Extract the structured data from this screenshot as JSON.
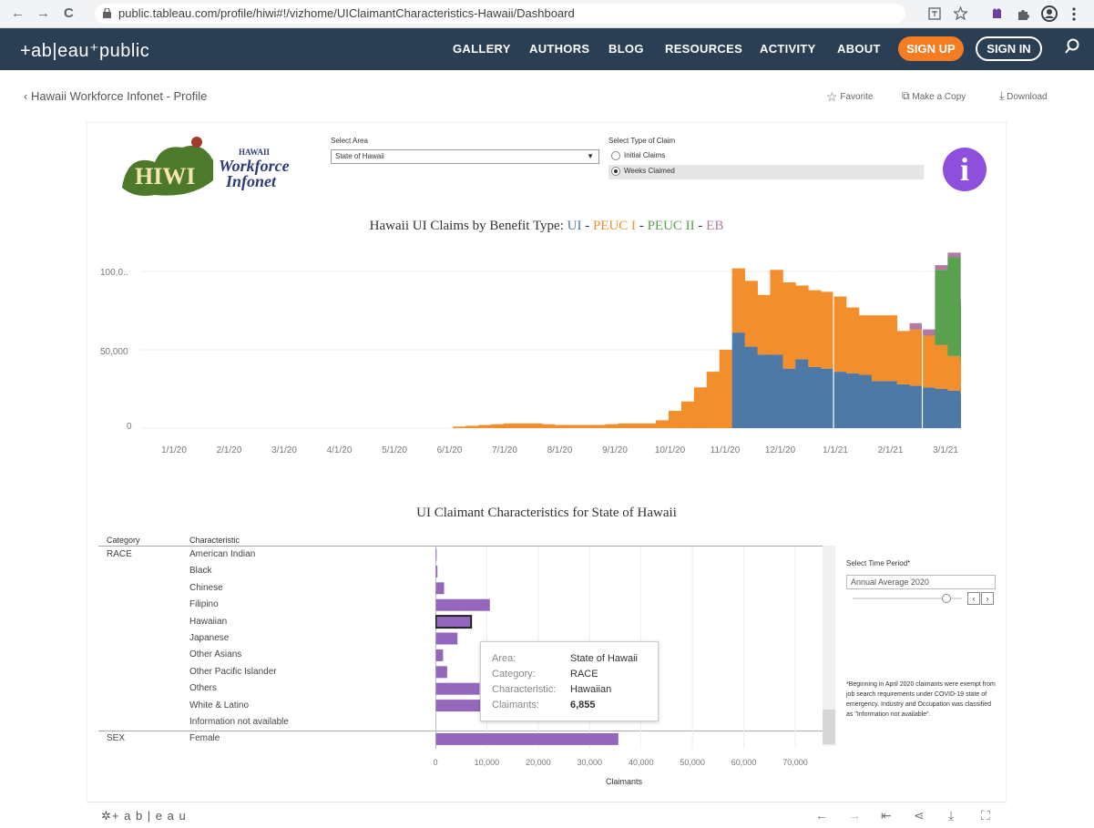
{
  "browser": {
    "url": "public.tableau.com/profile/hiwi#!/vizhome/UIClaimantCharacteristics-Hawaii/Dashboard",
    "back_glyph": "←",
    "forward_glyph": "→",
    "reload_glyph": "C"
  },
  "header": {
    "logo": "+ab|eau⁺public",
    "nav": [
      "GALLERY",
      "AUTHORS",
      "BLOG",
      "RESOURCES",
      "ACTIVITY",
      "ABOUT"
    ],
    "signup": "SIGN UP",
    "signin": "SIGN IN",
    "accent_color": "#f57c20",
    "bg_color": "#2a3f54"
  },
  "subheader": {
    "back_label": "Hawaii Workforce Infonet - Profile",
    "favorite": "Favorite",
    "copy": "Make a Copy",
    "download": "Download"
  },
  "dashboard": {
    "logo": {
      "badge": "HIWI",
      "line1": "HAWAII",
      "line2": "Workforce",
      "line3": "Infonet"
    },
    "select_area_label": "Select Area",
    "select_area_value": "State of Hawaii",
    "claim_type_label": "Select Type of Claim",
    "claim_options": [
      "Initial Claims",
      "Weeks Claimed"
    ],
    "claim_selected": "Weeks Claimed",
    "info_glyph": "i",
    "chart1_title_prefix": "Hawaii UI Claims by Benefit Type:",
    "chart1_title_parts": [
      "UI",
      "PEUC I",
      "PEUC II",
      "EB"
    ],
    "chart1_title_sep": " - ",
    "chart2_title": "UI Claimant Characteristics for State of Hawaii",
    "table_headers": {
      "category": "Category",
      "characteristic": "Characteristic"
    },
    "time_period_label": "Select Time Period*",
    "time_period_value": "Annual Average 2020",
    "note": "*Beginning in April 2020 claimants were exempt from job search requirements under COVID-19 state of emergency. Industry and Occupation was classified as \"Information not available\".",
    "tooltip": {
      "rows": [
        {
          "key": "Area:",
          "value": "State of Hawaii"
        },
        {
          "key": "Category:",
          "value": "RACE"
        },
        {
          "key": "Characteristic:",
          "value": "Hawaiian"
        },
        {
          "key": "Claimants:",
          "value": "6,855"
        }
      ]
    },
    "bottom_logo": "+ a b | e a u"
  },
  "chart_data": [
    {
      "type": "area",
      "title": "Hawaii UI Claims by Benefit Type: UI - PEUC I - PEUC II - EB",
      "x_ticks": [
        "1/1/20",
        "2/1/20",
        "3/1/20",
        "4/1/20",
        "5/1/20",
        "6/1/20",
        "7/1/20",
        "8/1/20",
        "9/1/20",
        "10/1/20",
        "11/1/20",
        "12/1/20",
        "1/1/21",
        "2/1/21",
        "3/1/21"
      ],
      "y_ticks": [
        "0",
        "50,000",
        "100,0.."
      ],
      "ylim": [
        0,
        120000
      ],
      "colors": {
        "UI": "#4e79a7",
        "PEUC I": "#f28e2b",
        "PEUC II": "#59a14f",
        "EB": "#b07aa1"
      },
      "weeks_from_start": [
        22,
        23,
        24,
        25,
        26,
        27,
        28,
        29,
        30,
        31,
        32,
        33,
        34,
        35,
        36,
        37,
        38,
        39,
        40,
        41,
        42,
        43,
        44,
        45,
        46,
        47,
        48,
        49,
        50,
        51,
        52,
        53,
        54,
        55,
        56,
        57,
        58,
        59,
        60,
        61,
        62
      ],
      "series": [
        {
          "name": "UI",
          "values": [
            0,
            0,
            0,
            0,
            0,
            0,
            0,
            0,
            0,
            0,
            0,
            0,
            0,
            0,
            0,
            0,
            0,
            0,
            0,
            0,
            0,
            0,
            61000,
            52000,
            47000,
            47000,
            38000,
            44000,
            39000,
            38000,
            36000,
            35000,
            34000,
            30000,
            30000,
            28000,
            27000,
            26000,
            25000,
            24000,
            22000
          ]
        },
        {
          "name": "PEUC I",
          "values": [
            1000,
            1500,
            2000,
            2500,
            3000,
            3000,
            3000,
            2500,
            2000,
            2000,
            2000,
            2000,
            2500,
            3000,
            3000,
            3000,
            5000,
            11000,
            17000,
            26000,
            36000,
            50000,
            41000,
            42000,
            38000,
            54000,
            55000,
            47000,
            49000,
            49000,
            48000,
            42000,
            38000,
            42000,
            42000,
            34000,
            36000,
            33000,
            28000,
            22000,
            21000
          ]
        },
        {
          "name": "PEUC II",
          "values": [
            0,
            0,
            0,
            0,
            0,
            0,
            0,
            0,
            0,
            0,
            0,
            0,
            0,
            0,
            0,
            0,
            0,
            0,
            0,
            0,
            0,
            0,
            0,
            0,
            0,
            0,
            0,
            0,
            0,
            0,
            0,
            0,
            0,
            0,
            0,
            0,
            0,
            0,
            48000,
            63000,
            37000
          ]
        },
        {
          "name": "EB",
          "values": [
            0,
            0,
            0,
            0,
            0,
            0,
            0,
            0,
            0,
            0,
            0,
            0,
            0,
            0,
            0,
            0,
            0,
            0,
            0,
            0,
            0,
            0,
            0,
            0,
            0,
            0,
            0,
            0,
            0,
            0,
            0,
            0,
            0,
            0,
            0,
            0,
            4000,
            4000,
            3000,
            3000,
            2000
          ]
        }
      ]
    },
    {
      "type": "bar",
      "title": "UI Claimant Characteristics for State of Hawaii",
      "xlabel": "Claimants",
      "x_ticks": [
        "0",
        "10,000",
        "20,000",
        "30,000",
        "40,000",
        "50,000",
        "60,000",
        "70,000"
      ],
      "xlim": [
        0,
        70000
      ],
      "color": "#9467bd",
      "highlight": "Hawaiian",
      "rows": [
        {
          "category": "RACE",
          "characteristic": "American Indian",
          "value": 150
        },
        {
          "category": "",
          "characteristic": "Black",
          "value": 300
        },
        {
          "category": "",
          "characteristic": "Chinese",
          "value": 1600
        },
        {
          "category": "",
          "characteristic": "Filipino",
          "value": 10500
        },
        {
          "category": "",
          "characteristic": "Hawaiian",
          "value": 6855
        },
        {
          "category": "",
          "characteristic": "Japanese",
          "value": 4200
        },
        {
          "category": "",
          "characteristic": "Other Asians",
          "value": 1400
        },
        {
          "category": "",
          "characteristic": "Other Pacific Islander",
          "value": 2200
        },
        {
          "category": "",
          "characteristic": "Others",
          "value": 8500
        },
        {
          "category": "",
          "characteristic": "White & Latino",
          "value": 9000
        },
        {
          "category": "",
          "characteristic": "Information not available",
          "value": 0
        },
        {
          "category": "SEX",
          "characteristic": "Female",
          "value": 35500
        }
      ]
    }
  ]
}
